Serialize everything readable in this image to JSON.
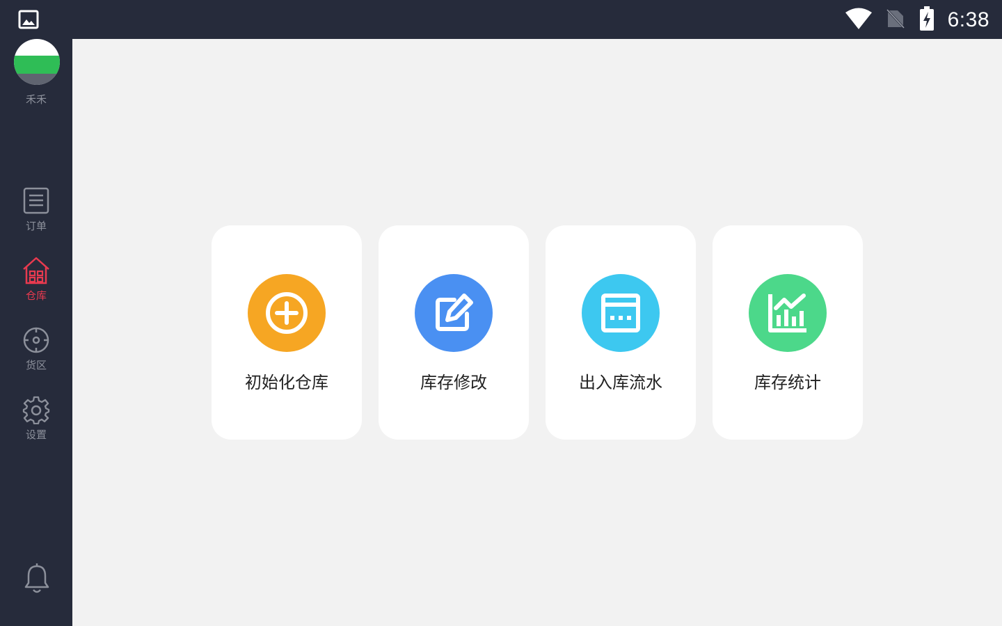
{
  "status_bar": {
    "time": "6:38"
  },
  "user": {
    "name": "禾禾"
  },
  "sidebar": {
    "items": [
      {
        "label": "订单",
        "icon": "list-icon",
        "active": false
      },
      {
        "label": "仓库",
        "icon": "warehouse-icon",
        "active": true
      },
      {
        "label": "货区",
        "icon": "target-icon",
        "active": false
      },
      {
        "label": "设置",
        "icon": "gear-icon",
        "active": false
      }
    ],
    "active_color": "#e83a4f",
    "inactive_color": "#8c909b"
  },
  "cards": [
    {
      "label": "初始化仓库",
      "icon": "plus-circle-icon",
      "color": "#f6a623"
    },
    {
      "label": "库存修改",
      "icon": "edit-icon",
      "color": "#4a90f2"
    },
    {
      "label": "出入库流水",
      "icon": "ledger-icon",
      "color": "#3dc8f0"
    },
    {
      "label": "库存统计",
      "icon": "chart-icon",
      "color": "#4cd88a"
    }
  ]
}
